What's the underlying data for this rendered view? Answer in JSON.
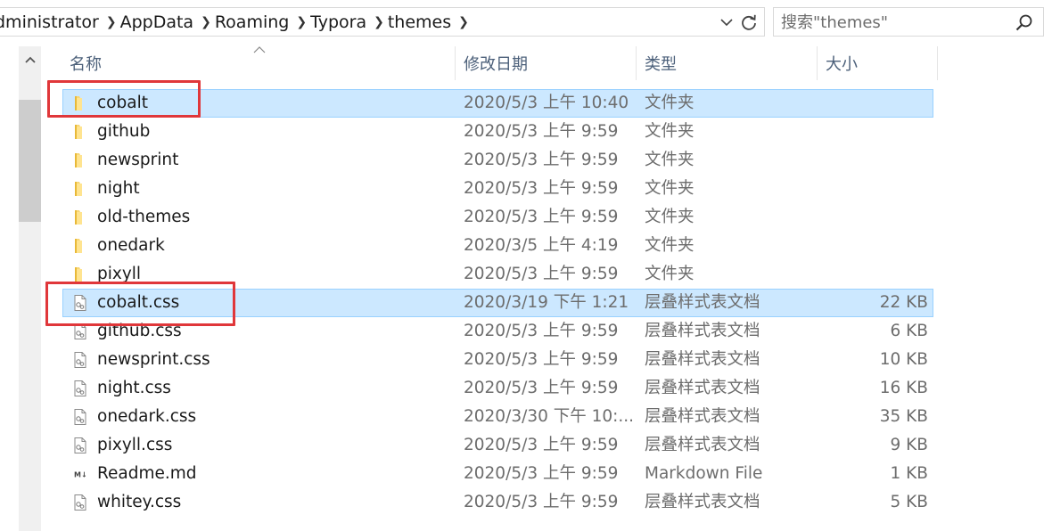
{
  "address_bar": {
    "crumbs": [
      "dministrator",
      "AppData",
      "Roaming",
      "Typora",
      "themes"
    ],
    "dropdown_icon": "chevron-down-icon",
    "refresh_icon": "refresh-icon"
  },
  "search": {
    "placeholder": "搜索\"themes\"",
    "icon": "search-icon"
  },
  "columns": {
    "name": "名称",
    "date": "修改日期",
    "type": "类型",
    "size": "大小"
  },
  "files": [
    {
      "name": "cobalt",
      "date": "2020/5/3 上午 10:40",
      "type": "文件夹",
      "size": "",
      "kind": "folder",
      "selected": true
    },
    {
      "name": "github",
      "date": "2020/5/3 上午 9:59",
      "type": "文件夹",
      "size": "",
      "kind": "folder",
      "selected": false
    },
    {
      "name": "newsprint",
      "date": "2020/5/3 上午 9:59",
      "type": "文件夹",
      "size": "",
      "kind": "folder",
      "selected": false
    },
    {
      "name": "night",
      "date": "2020/5/3 上午 9:59",
      "type": "文件夹",
      "size": "",
      "kind": "folder",
      "selected": false
    },
    {
      "name": "old-themes",
      "date": "2020/5/3 上午 9:59",
      "type": "文件夹",
      "size": "",
      "kind": "folder",
      "selected": false
    },
    {
      "name": "onedark",
      "date": "2020/3/5 上午 4:19",
      "type": "文件夹",
      "size": "",
      "kind": "folder",
      "selected": false
    },
    {
      "name": "pixyll",
      "date": "2020/5/3 上午 9:59",
      "type": "文件夹",
      "size": "",
      "kind": "folder",
      "selected": false
    },
    {
      "name": "cobalt.css",
      "date": "2020/3/19 下午 1:21",
      "type": "层叠样式表文档",
      "size": "22 KB",
      "kind": "css",
      "selected": true
    },
    {
      "name": "github.css",
      "date": "2020/5/3 上午 9:59",
      "type": "层叠样式表文档",
      "size": "6 KB",
      "kind": "css",
      "selected": false
    },
    {
      "name": "newsprint.css",
      "date": "2020/5/3 上午 9:59",
      "type": "层叠样式表文档",
      "size": "10 KB",
      "kind": "css",
      "selected": false
    },
    {
      "name": "night.css",
      "date": "2020/5/3 上午 9:59",
      "type": "层叠样式表文档",
      "size": "16 KB",
      "kind": "css",
      "selected": false
    },
    {
      "name": "onedark.css",
      "date": "2020/3/30 下午 10:...",
      "type": "层叠样式表文档",
      "size": "35 KB",
      "kind": "css",
      "selected": false
    },
    {
      "name": "pixyll.css",
      "date": "2020/5/3 上午 9:59",
      "type": "层叠样式表文档",
      "size": "9 KB",
      "kind": "css",
      "selected": false
    },
    {
      "name": "Readme.md",
      "date": "2020/5/3 上午 9:59",
      "type": "Markdown File",
      "size": "1 KB",
      "kind": "md",
      "selected": false
    },
    {
      "name": "whitey.css",
      "date": "2020/5/3 上午 9:59",
      "type": "层叠样式表文档",
      "size": "5 KB",
      "kind": "css",
      "selected": false
    }
  ],
  "colors": {
    "selection": "#cce8ff",
    "selection_border": "#99d1ff",
    "folder": "#f8d775",
    "annotation": "#e0373a",
    "header_text": "#4c607a"
  }
}
